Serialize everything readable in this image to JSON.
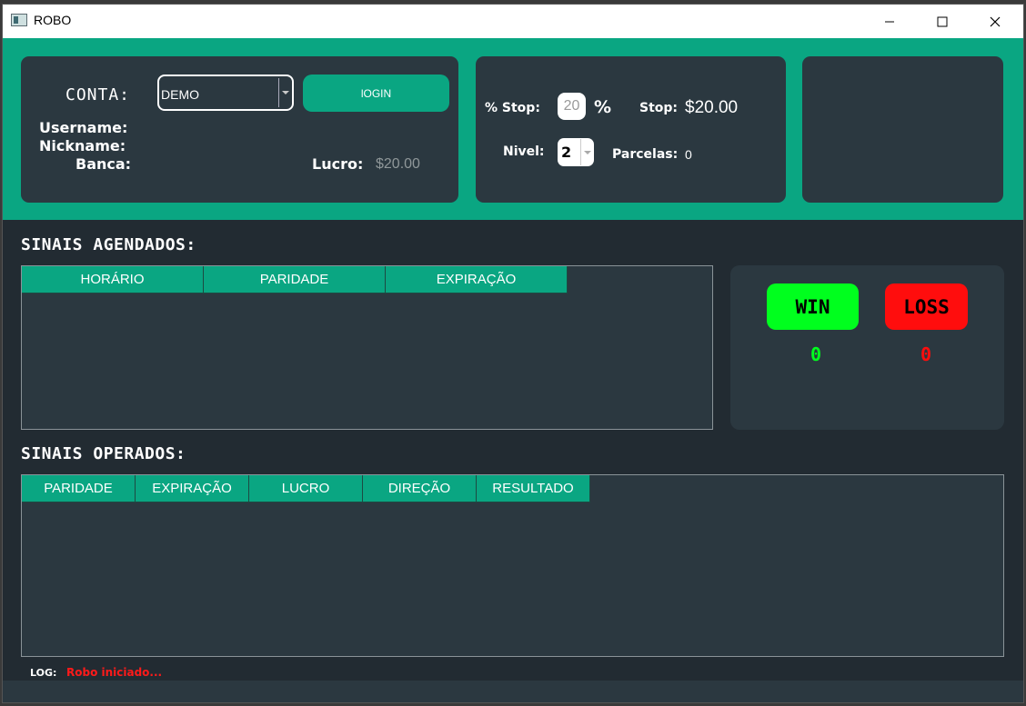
{
  "window": {
    "title": "ROBO",
    "icon": "app-window-icon"
  },
  "account": {
    "conta_label": "CONTA:",
    "account_type": "DEMO",
    "login_label": "lOGIN",
    "username_label": "Username:",
    "nickname_label": "Nickname:",
    "banca_label": "Banca:",
    "lucro_label": "Lucro:",
    "lucro_value": "$20.00"
  },
  "stop": {
    "pct_label": "% Stop:",
    "pct_value": "20",
    "pct_sign": "%",
    "stop_label": "Stop:",
    "stop_value": "$20.00",
    "nivel_label": "Nivel:",
    "nivel_value": "2",
    "parcelas_label": "Parcelas:",
    "parcelas_value": "0"
  },
  "agendados": {
    "title": "SINAIS AGENDADOS:",
    "columns": [
      "HORÁRIO",
      "PARIDADE",
      "EXPIRAÇÃO"
    ]
  },
  "operados": {
    "title": "SINAIS OPERADOS:",
    "columns": [
      "PARIDADE",
      "EXPIRAÇÃO",
      "LUCRO",
      "DIREÇÃO",
      "RESULTADO"
    ]
  },
  "score": {
    "win_label": "WIN",
    "loss_label": "LOSS",
    "win_count": "0",
    "loss_count": "0",
    "win_color": "#00ff1e",
    "loss_color": "#ff0d0d"
  },
  "log": {
    "label": "LOG:",
    "message": "Robo iniciado..."
  },
  "colors": {
    "accent": "#0aa682",
    "panel": "#2b3840",
    "background": "#222b32"
  }
}
